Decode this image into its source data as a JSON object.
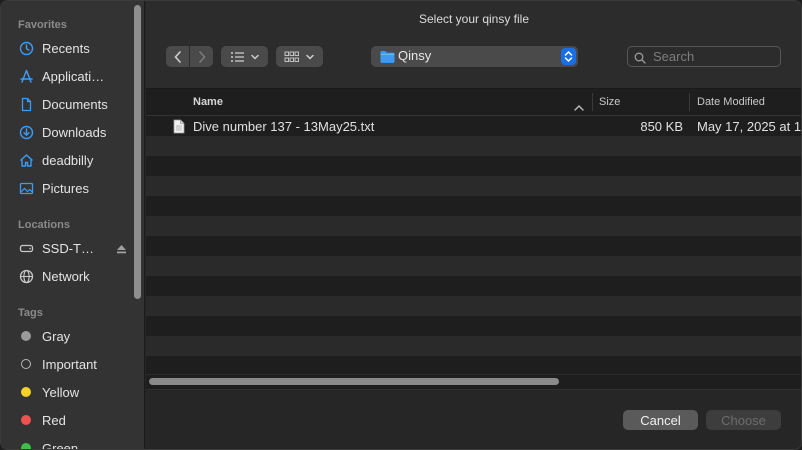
{
  "window": {
    "title": "Select your qinsy file"
  },
  "sidebar": {
    "favorites_header": "Favorites",
    "favorites": [
      {
        "label": "Recents",
        "icon": "clock-icon"
      },
      {
        "label": "Applicati…",
        "icon": "applications-icon"
      },
      {
        "label": "Documents",
        "icon": "document-icon"
      },
      {
        "label": "Downloads",
        "icon": "download-icon"
      },
      {
        "label": "deadbilly",
        "icon": "home-icon"
      },
      {
        "label": "Pictures",
        "icon": "pictures-icon"
      }
    ],
    "locations_header": "Locations",
    "locations": [
      {
        "label": "SSD-T…",
        "icon": "drive-icon"
      },
      {
        "label": "Network",
        "icon": "globe-icon"
      }
    ],
    "tags_header": "Tags",
    "tags": [
      {
        "label": "Gray",
        "color": "#9a9a9a"
      },
      {
        "label": "Important",
        "color": ""
      },
      {
        "label": "Yellow",
        "color": "#f5d12a"
      },
      {
        "label": "Red",
        "color": "#f0534f"
      },
      {
        "label": "Green",
        "color": "#3fbf4a"
      }
    ]
  },
  "toolbar": {
    "location": "Qinsy",
    "search_placeholder": "Search"
  },
  "columns": {
    "name": "Name",
    "size": "Size",
    "date": "Date Modified"
  },
  "files": [
    {
      "name": "Dive number 137 - 13May25.txt",
      "size": "850 KB",
      "date": "May 17, 2025 at 1"
    }
  ],
  "buttons": {
    "cancel": "Cancel",
    "choose": "Choose"
  },
  "colors": {
    "accent": "#1a6fe4",
    "folder": "#3d9bf5"
  }
}
